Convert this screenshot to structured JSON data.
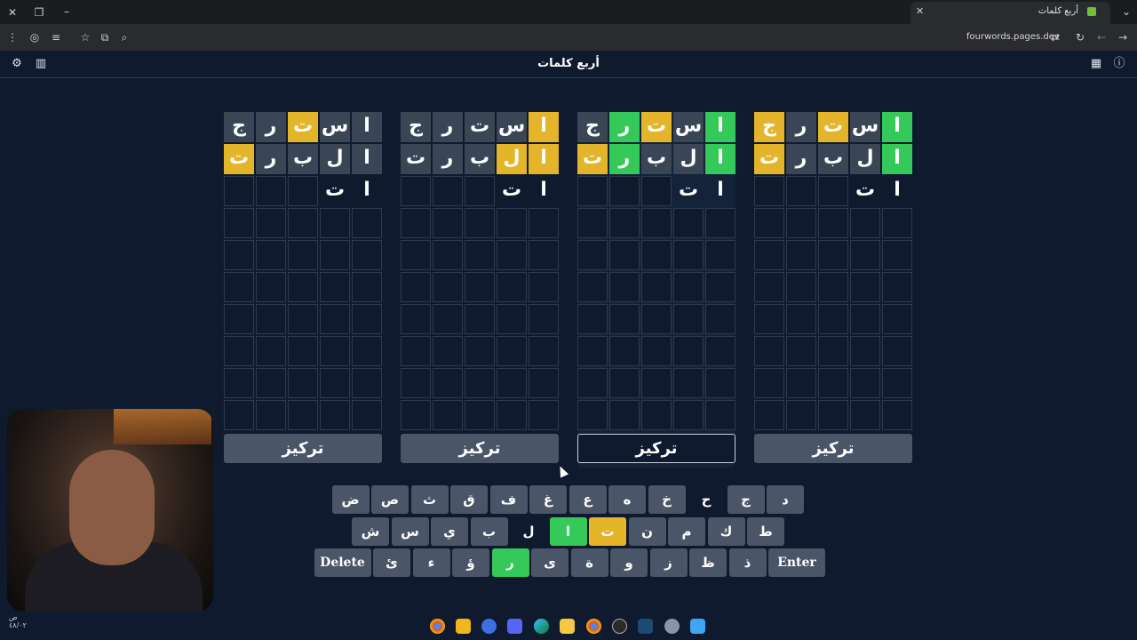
{
  "browser": {
    "tab_title": "أربع كلمات",
    "url": "fourwords.pages.dev"
  },
  "app": {
    "title": "أربع كلمات",
    "icons": {
      "left": [
        "gear-icon",
        "chart-icon"
      ],
      "right": [
        "calendar-icon",
        "info-icon"
      ]
    }
  },
  "colors": {
    "background": "#0f1a2e",
    "filled": "#3a4656",
    "present": "#e4b42a",
    "correct": "#35c95a",
    "key": "#4a5567"
  },
  "boards": [
    {
      "focus_label": "تركيز",
      "focused": false,
      "rows": [
        [
          {
            "l": "ا",
            "s": "f"
          },
          {
            "l": "س",
            "s": "f"
          },
          {
            "l": "ت",
            "s": "y"
          },
          {
            "l": "ر",
            "s": "f"
          },
          {
            "l": "ج",
            "s": "f"
          }
        ],
        [
          {
            "l": "ا",
            "s": "f"
          },
          {
            "l": "ل",
            "s": "f"
          },
          {
            "l": "ب",
            "s": "f"
          },
          {
            "l": "ر",
            "s": "f"
          },
          {
            "l": "ت",
            "s": "y"
          }
        ],
        [
          {
            "l": "ا",
            "s": "t"
          },
          {
            "l": "ت",
            "s": "t"
          },
          {
            "l": "",
            "s": "e"
          },
          {
            "l": "",
            "s": "e"
          },
          {
            "l": "",
            "s": "e"
          }
        ]
      ]
    },
    {
      "focus_label": "تركيز",
      "focused": false,
      "rows": [
        [
          {
            "l": "ا",
            "s": "y"
          },
          {
            "l": "س",
            "s": "f"
          },
          {
            "l": "ت",
            "s": "f"
          },
          {
            "l": "ر",
            "s": "f"
          },
          {
            "l": "ج",
            "s": "f"
          }
        ],
        [
          {
            "l": "ا",
            "s": "y"
          },
          {
            "l": "ل",
            "s": "y"
          },
          {
            "l": "ب",
            "s": "f"
          },
          {
            "l": "ر",
            "s": "f"
          },
          {
            "l": "ت",
            "s": "f"
          }
        ],
        [
          {
            "l": "ا",
            "s": "t"
          },
          {
            "l": "ت",
            "s": "t"
          },
          {
            "l": "",
            "s": "e"
          },
          {
            "l": "",
            "s": "e"
          },
          {
            "l": "",
            "s": "e"
          }
        ]
      ]
    },
    {
      "focus_label": "تركيز",
      "focused": true,
      "rows": [
        [
          {
            "l": "ا",
            "s": "g"
          },
          {
            "l": "س",
            "s": "f"
          },
          {
            "l": "ت",
            "s": "y"
          },
          {
            "l": "ر",
            "s": "g"
          },
          {
            "l": "ج",
            "s": "f"
          }
        ],
        [
          {
            "l": "ا",
            "s": "g"
          },
          {
            "l": "ل",
            "s": "f"
          },
          {
            "l": "ب",
            "s": "f"
          },
          {
            "l": "ر",
            "s": "g"
          },
          {
            "l": "ت",
            "s": "y"
          }
        ],
        [
          {
            "l": "ا",
            "s": "t"
          },
          {
            "l": "ت",
            "s": "t"
          },
          {
            "l": "",
            "s": "e"
          },
          {
            "l": "",
            "s": "e"
          },
          {
            "l": "",
            "s": "e"
          }
        ]
      ]
    },
    {
      "focus_label": "تركيز",
      "focused": false,
      "rows": [
        [
          {
            "l": "ا",
            "s": "g"
          },
          {
            "l": "س",
            "s": "f"
          },
          {
            "l": "ت",
            "s": "y"
          },
          {
            "l": "ر",
            "s": "f"
          },
          {
            "l": "ج",
            "s": "y"
          }
        ],
        [
          {
            "l": "ا",
            "s": "g"
          },
          {
            "l": "ل",
            "s": "f"
          },
          {
            "l": "ب",
            "s": "f"
          },
          {
            "l": "ر",
            "s": "f"
          },
          {
            "l": "ت",
            "s": "y"
          }
        ],
        [
          {
            "l": "ا",
            "s": "t"
          },
          {
            "l": "ت",
            "s": "t"
          },
          {
            "l": "",
            "s": "e"
          },
          {
            "l": "",
            "s": "e"
          },
          {
            "l": "",
            "s": "e"
          }
        ]
      ]
    }
  ],
  "keyboard": {
    "row1": [
      {
        "k": "د",
        "s": ""
      },
      {
        "k": "ج",
        "s": ""
      },
      {
        "k": "ح",
        "s": "d"
      },
      {
        "k": "خ",
        "s": ""
      },
      {
        "k": "ه",
        "s": ""
      },
      {
        "k": "ع",
        "s": ""
      },
      {
        "k": "غ",
        "s": ""
      },
      {
        "k": "ف",
        "s": ""
      },
      {
        "k": "ق",
        "s": ""
      },
      {
        "k": "ث",
        "s": ""
      },
      {
        "k": "ص",
        "s": ""
      },
      {
        "k": "ض",
        "s": ""
      }
    ],
    "row2": [
      {
        "k": "ط",
        "s": ""
      },
      {
        "k": "ك",
        "s": ""
      },
      {
        "k": "م",
        "s": ""
      },
      {
        "k": "ن",
        "s": ""
      },
      {
        "k": "ت",
        "s": "y"
      },
      {
        "k": "ا",
        "s": "g"
      },
      {
        "k": "ل",
        "s": "d"
      },
      {
        "k": "ب",
        "s": ""
      },
      {
        "k": "ي",
        "s": ""
      },
      {
        "k": "س",
        "s": ""
      },
      {
        "k": "ش",
        "s": ""
      }
    ],
    "row3": [
      {
        "k": "Enter",
        "s": "",
        "wide": true
      },
      {
        "k": "ذ",
        "s": ""
      },
      {
        "k": "ظ",
        "s": ""
      },
      {
        "k": "ز",
        "s": ""
      },
      {
        "k": "و",
        "s": ""
      },
      {
        "k": "ة",
        "s": ""
      },
      {
        "k": "ى",
        "s": ""
      },
      {
        "k": "ر",
        "s": "g"
      },
      {
        "k": "ؤ",
        "s": ""
      },
      {
        "k": "ء",
        "s": ""
      },
      {
        "k": "ئ",
        "s": ""
      },
      {
        "k": "Delete",
        "s": "",
        "wide": true
      }
    ]
  },
  "clock": {
    "line1": "ص",
    "line2": "٤٨/٠٢"
  }
}
